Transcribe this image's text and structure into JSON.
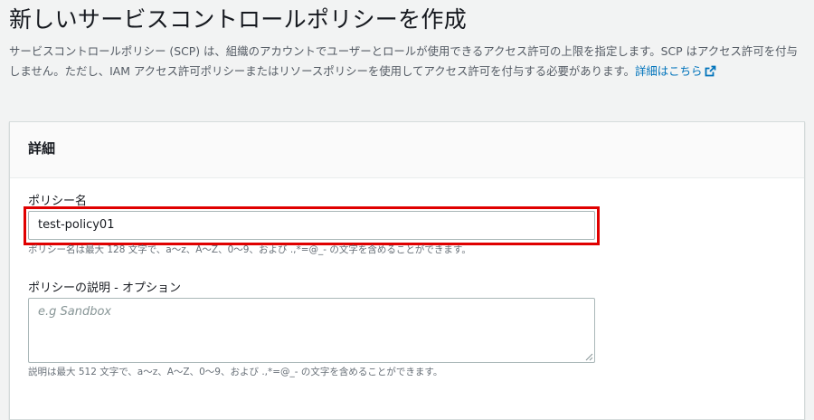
{
  "page": {
    "title": "新しいサービスコントロールポリシーを作成",
    "description": "サービスコントロールポリシー (SCP) は、組織のアカウントでユーザーとロールが使用できるアクセス許可の上限を指定します。SCP はアクセス許可を付与しません。ただし、IAM アクセス許可ポリシーまたはリソースポリシーを使用してアクセス許可を付与する必要があります。",
    "learn_more_link": "詳細はこちら",
    "learn_more_icon": "external-link-icon"
  },
  "details_panel": {
    "title": "詳細",
    "policy_name": {
      "label": "ポリシー名",
      "value": "test-policy01",
      "hint": "ポリシー名は最大 128 文字で、a～z、A～Z、0～9、および .,*=@_- の文字を含めることができます。"
    },
    "policy_description": {
      "label": "ポリシーの説明 - オプション",
      "placeholder": "e.g Sandbox",
      "value": "",
      "hint": "説明は最大 512 文字で、a～z、A～Z、0～9、および .,*=@_- の文字を含めることができます。"
    }
  },
  "colors": {
    "highlight_border": "#e00000",
    "link": "#0073bb",
    "background": "#f2f3f3"
  }
}
